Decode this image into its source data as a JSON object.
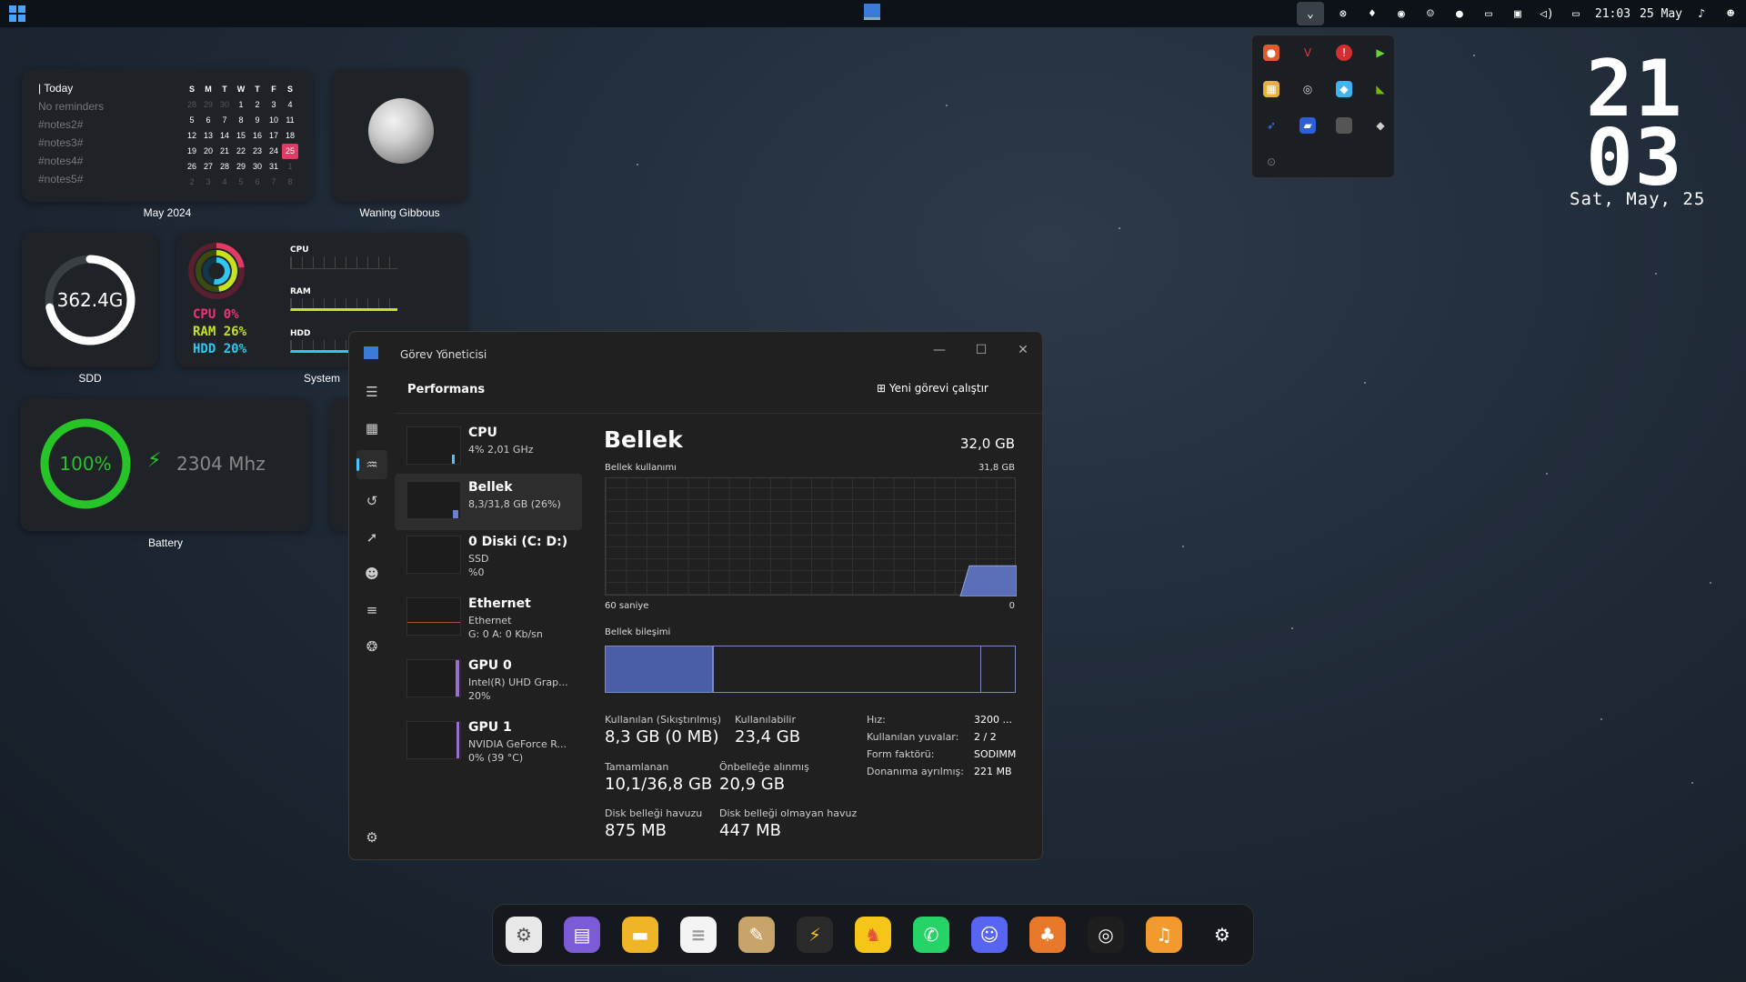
{
  "topbar": {
    "time": "21:03",
    "date": "25 May",
    "tray_icons": [
      "chevron-up-icon",
      "xbox-icon",
      "drop-icon",
      "steam-icon",
      "discord-icon",
      "app-icon",
      "network-icon",
      "display-icon",
      "volume-icon",
      "battery-icon"
    ]
  },
  "calendar": {
    "today_label": "| Today",
    "reminders": [
      "No reminders",
      "#notes2#",
      "#notes3#",
      "#notes4#",
      "#notes5#"
    ],
    "weekdays": [
      "S",
      "M",
      "T",
      "W",
      "T",
      "F",
      "S"
    ],
    "weeks": [
      [
        "28",
        "29",
        "30",
        "1",
        "2",
        "3",
        "4"
      ],
      [
        "5",
        "6",
        "7",
        "8",
        "9",
        "10",
        "11"
      ],
      [
        "12",
        "13",
        "14",
        "15",
        "16",
        "17",
        "18"
      ],
      [
        "19",
        "20",
        "21",
        "22",
        "23",
        "24",
        "25"
      ],
      [
        "26",
        "27",
        "28",
        "29",
        "30",
        "31",
        "1"
      ],
      [
        "2",
        "3",
        "4",
        "5",
        "6",
        "7",
        "8"
      ]
    ],
    "today": "25",
    "label": "May 2024"
  },
  "moon": {
    "label": "Waning Gibbous"
  },
  "ssd": {
    "value": "362.4G",
    "label": "SDD",
    "fill": 0.72
  },
  "system": {
    "cpu": "CPU 0%",
    "ram": "RAM 26%",
    "hdd": "HDD 20%",
    "graph_labels": [
      "CPU",
      "RAM",
      "HDD"
    ],
    "label": "System"
  },
  "battery": {
    "percent": "100%",
    "freq": "2304 Mhz",
    "label": "Battery",
    "fill": 1.0
  },
  "clock": {
    "hour": "21",
    "minute": "03",
    "date": "Sat, May, 25"
  },
  "taskmanager": {
    "title": "Görev Yöneticisi",
    "page_title": "Performans",
    "run_task": "Yeni görevi çalıştır",
    "more": "•••",
    "items": [
      {
        "name": "CPU",
        "sub1": "4% 2,01 GHz",
        "sub2": ""
      },
      {
        "name": "Bellek",
        "sub1": "8,3/31,8 GB (26%)",
        "sub2": ""
      },
      {
        "name": "0 Diski (C: D:)",
        "sub1": "SSD",
        "sub2": "%0"
      },
      {
        "name": "Ethernet",
        "sub1": "Ethernet",
        "sub2": "G: 0 A: 0 Kb/sn"
      },
      {
        "name": "GPU 0",
        "sub1": "Intel(R) UHD Grap...",
        "sub2": "20%"
      },
      {
        "name": "GPU 1",
        "sub1": "NVIDIA GeForce R...",
        "sub2": "0% (39 °C)"
      }
    ],
    "detail": {
      "title": "Bellek",
      "capacity": "32,0 GB",
      "usage_label": "Bellek kullanımı",
      "usage_max": "31,8 GB",
      "time_left": "60 saniye",
      "time_right": "0",
      "composition_label": "Bellek bileşimi",
      "usage_fraction": 0.26,
      "stats": [
        {
          "k": "Kullanılan (Sıkıştırılmış)",
          "v": "8,3 GB (0 MB)"
        },
        {
          "k": "Kullanılabilir",
          "v": "23,4 GB"
        },
        {
          "k": "Tamamlanan",
          "v": "10,1/36,8 GB"
        },
        {
          "k": "Önbelleğe alınmış",
          "v": "20,9 GB"
        },
        {
          "k": "Disk belleği havuzu",
          "v": "875 MB"
        },
        {
          "k": "Disk belleği olmayan havuz",
          "v": "447 MB"
        }
      ],
      "specs": [
        {
          "k": "Hız:",
          "v": "3200 ..."
        },
        {
          "k": "Kullanılan yuvalar:",
          "v": "2 / 2"
        },
        {
          "k": "Form faktörü:",
          "v": "SODIMM"
        },
        {
          "k": "Donanıma ayrılmış:",
          "v": "221 MB"
        }
      ]
    }
  },
  "dock": {
    "apps": [
      {
        "name": "settings-app-icon",
        "glyph": "⚙",
        "color": "#e8e8e8",
        "fg": "#555"
      },
      {
        "name": "store-app-icon",
        "glyph": "▤",
        "color": "#7b5cd6",
        "fg": "#fff"
      },
      {
        "name": "files-app-icon",
        "glyph": "▬",
        "color": "#f0b429",
        "fg": "#fff"
      },
      {
        "name": "notes-app-icon",
        "glyph": "≡",
        "color": "#f4f4f4",
        "fg": "#999"
      },
      {
        "name": "paint-app-icon",
        "glyph": "✎",
        "color": "#c9a46a",
        "fg": "#fff"
      },
      {
        "name": "terminal-app-icon",
        "glyph": "⚡",
        "color": "#2a2a2a",
        "fg": "#f5c518"
      },
      {
        "name": "brave-app-icon",
        "glyph": "♞",
        "color": "#f5c518",
        "fg": "#e2533a"
      },
      {
        "name": "whatsapp-app-icon",
        "glyph": "✆",
        "color": "#25d366",
        "fg": "#fff"
      },
      {
        "name": "discord-app-icon",
        "glyph": "☺",
        "color": "#5865f2",
        "fg": "#fff"
      },
      {
        "name": "fox-app-icon",
        "glyph": "♣",
        "color": "#e8792b",
        "fg": "#fff"
      },
      {
        "name": "obs-app-icon",
        "glyph": "◎",
        "color": "#1e1e1e",
        "fg": "#fff"
      },
      {
        "name": "headphones-app-icon",
        "glyph": "♫",
        "color": "#f29a2e",
        "fg": "#fff"
      },
      {
        "name": "steam-app-icon",
        "glyph": "⚙",
        "color": "#15181c",
        "fg": "#fff"
      }
    ]
  }
}
